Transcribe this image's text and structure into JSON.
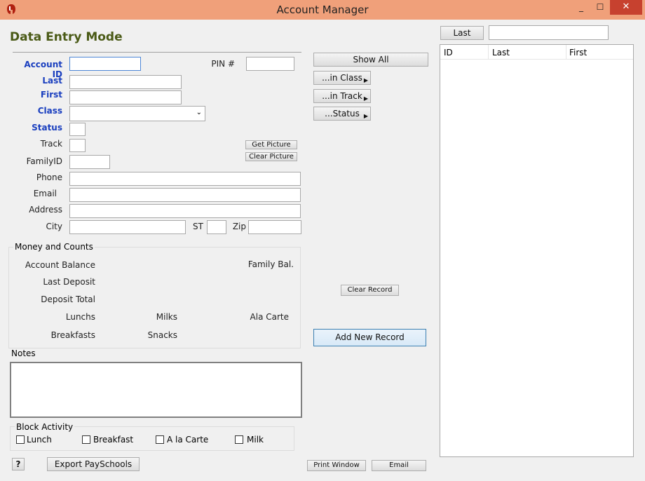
{
  "window": {
    "title": "Account Manager",
    "minimize": "_",
    "maximize": "☐",
    "close": "✕"
  },
  "header": {
    "mode_title": "Data Entry Mode"
  },
  "fields": {
    "account_id": "Account ID",
    "pin": "PIN #",
    "last": "Last",
    "first": "First",
    "class": "Class",
    "status": "Status",
    "track": "Track",
    "family_id": "FamilyID",
    "phone": "Phone",
    "email": "Email",
    "address": "Address",
    "city": "City",
    "st": "ST",
    "zip": "Zip"
  },
  "buttons": {
    "show_all": "Show All",
    "in_class": "...in Class",
    "in_track": "...in Track",
    "status": "...Status",
    "get_picture": "Get Picture",
    "clear_picture": "Clear Picture",
    "clear_record": "Clear Record",
    "add_new_record": "Add New Record",
    "export_payschools": "Export PaySchools",
    "print_window": "Print Window",
    "email": "Email",
    "help": "?"
  },
  "money": {
    "group_title": "Money and Counts",
    "account_balance": "Account Balance",
    "family_bal": "Family Bal.",
    "last_deposit": "Last Deposit",
    "deposit_total": "Deposit Total",
    "lunchs": "Lunchs",
    "milks": "Milks",
    "ala_carte": "Ala Carte",
    "breakfasts": "Breakfasts",
    "snacks": "Snacks"
  },
  "notes": {
    "label": "Notes"
  },
  "block": {
    "title": "Block Activity",
    "lunch": "Lunch",
    "breakfast": "Breakfast",
    "a_la_carte": "A la Carte",
    "milk": "Milk"
  },
  "search": {
    "last_button": "Last"
  },
  "list": {
    "columns": [
      "ID",
      "Last",
      "First"
    ]
  },
  "colors": {
    "title_bar": "#f0a07a",
    "mode_title": "#4a5a16",
    "label_blue": "#1a3fbf",
    "close": "#c7412f"
  }
}
